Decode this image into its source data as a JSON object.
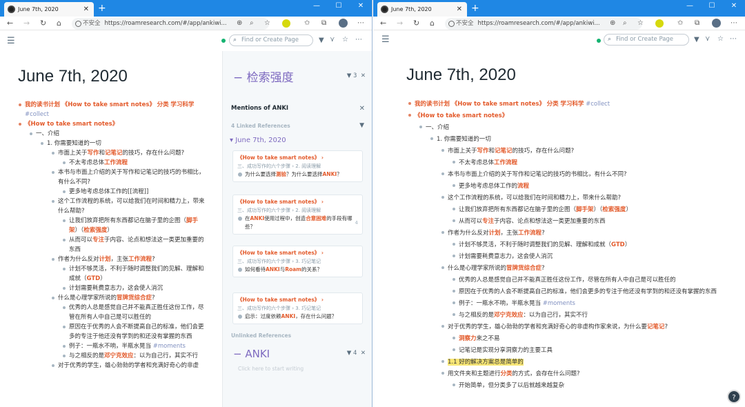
{
  "browser": {
    "tab_title": "June 7th, 2020",
    "new_tab": "+",
    "insecure": "不安全",
    "url_left": "https://roamresearch.com/#/app/ankiwi...",
    "url_right": "https://roamresearch.com/#/app/ankiwi..."
  },
  "search": {
    "placeholder": "Find or Create Page"
  },
  "page": {
    "title": "June 7th, 2020"
  },
  "sidebar": {
    "block_title": "检索强度",
    "block_count": "3",
    "mentions_label": "Mentions of ANKI",
    "linked_refs": "4 Linked References",
    "ref_date": "June 7th, 2020",
    "cards": [
      {
        "ref": "《How to take smart notes》",
        "crumb": "三、成功写作的六个步骤 › 2. 阅读理解",
        "text": "为什么要选择",
        "hl1": "测验",
        "text2": "？为什么要选择",
        "hl2": "ANKI",
        "text3": "？",
        "num": ""
      },
      {
        "ref": "《How to take smart notes》",
        "crumb": "三、成功写作的六个步骤 › 2. 阅读理解",
        "text": "在",
        "hl1": "ANKI",
        "text2": "使用过程中，创造",
        "hl2": "合意困难",
        "text3": "的手段有哪些？",
        "num": "4"
      },
      {
        "ref": "《How to take smart notes》",
        "crumb": "三、成功写作的六个步骤 › 3. 巧记笔记",
        "text": "如何看待",
        "hl1": "ANKI",
        "text2": "与",
        "hl2": "Roam",
        "text3": "的关系？",
        "num": ""
      },
      {
        "ref": "《How to take smart notes》",
        "crumb": "三、成功写作的六个步骤 › 3. 巧记笔记",
        "text": "启示：过度依赖",
        "hl1": "ANKI",
        "text2": "，存在什么问题？",
        "hl2": "",
        "text3": "",
        "num": ""
      }
    ],
    "unlinked_refs": "Unlinked References",
    "anki_title": "ANKI",
    "anki_count": "4",
    "click_here": "Click here to start writing"
  },
  "left_blocks": [
    {
      "d": 0,
      "red": true,
      "html": "<span class='ref'>我的读书计划</span> <span class='ref'>《How to take smart notes》</span> <span class='ref'>分类</span> <span class='ref'>学习科学</span> <span class='tag'>#collect</span>"
    },
    {
      "d": 0,
      "red": true,
      "html": "<span class='ref'>《How to take smart notes》</span>"
    },
    {
      "d": 1,
      "html": "一、介绍"
    },
    {
      "d": 2,
      "html": "1. 你需要知道的一切"
    },
    {
      "d": 3,
      "html": "市面上关于<span class='ref'>写作</span>和<span class='ref'>记笔记</span>的技巧，存在什么问题?"
    },
    {
      "d": 4,
      "html": "不太考虑总体<span class='ref'>工作流程</span>"
    },
    {
      "d": 3,
      "html": "本书与市面上介绍的关于写作和记笔记的技巧的书相比，有什么不同?"
    },
    {
      "d": 4,
      "html": "更多地考虑总体工作的[[流程]]"
    },
    {
      "d": 3,
      "html": "这个工作流程的系统，可以给我们在时间和精力上，带来什么帮助?"
    },
    {
      "d": 4,
      "html": "让我们放弃把所有东西都记在脑子里的企图（<span class='ref'>脚手架</span>）（<span class='ref'>检索强度</span>）"
    },
    {
      "d": 4,
      "html": "从而可以<span class='ref'>专注</span>于内容、论点和想法这一类更加重要的东西"
    },
    {
      "d": 3,
      "html": "作者为什么反对<span class='ref'>计划</span>，主张<span class='ref'>工作流程</span>?"
    },
    {
      "d": 4,
      "html": "计划不够灵活，不利于随时调整我们的见解、理解和成就（<span class='ref'>GTD</span>）"
    },
    {
      "d": 4,
      "html": "计划需要耗费意志力，这会使人消沉"
    },
    {
      "d": 3,
      "html": "什么是心理学家所说的<span class='ref'>冒牌货综合症</span>?"
    },
    {
      "d": 4,
      "html": "优秀的人总是感觉自己并不能真正胜任这份工作，尽管在所有人中自己是可以胜任的"
    },
    {
      "d": 4,
      "html": "原因在于优秀的人会不断提高自己的标准，他们会更多的专注于他还没有学到的和还没有掌握的东西"
    },
    {
      "d": 4,
      "html": "例子：一瓶水不响，半瓶水晃当 <span class='tag'>#moments</span>"
    },
    {
      "d": 4,
      "html": "与之相反的是<span class='ref'>邓宁克效应</span>：以为自己行，其实不行"
    },
    {
      "d": 3,
      "html": "对于优秀的学生，雄心勃勃的学者和充满好奇心的非虚"
    }
  ],
  "right_blocks": [
    {
      "d": 0,
      "red": true,
      "html": "<span class='ref'>我的读书计划</span> <span class='ref'>《How to take smart notes》</span> <span class='ref'>分类</span> <span class='ref'>学习科学</span> <span class='tag'>#collect</span>"
    },
    {
      "d": 0,
      "red": true,
      "html": "<span class='ref'>《How to take smart notes》</span>"
    },
    {
      "d": 1,
      "html": "一、介绍"
    },
    {
      "d": 2,
      "html": "1. 你需要知道的一切"
    },
    {
      "d": 3,
      "html": "市面上关于<span class='ref'>写作</span>和<span class='ref'>记笔记</span>的技巧，存在什么问题?"
    },
    {
      "d": 4,
      "html": "不太考虑总体<span class='ref'>工作流程</span>"
    },
    {
      "d": 3,
      "html": "本书与市面上介绍的关于写作和记笔记的技巧的书相比，有什么不同?"
    },
    {
      "d": 4,
      "html": "更多地考虑总体工作的<span class='ref'>流程</span>"
    },
    {
      "d": 3,
      "html": "这个工作流程的系统，可以给我们在时间和精力上，带来什么帮助?"
    },
    {
      "d": 4,
      "html": "让我们放弃把所有东西都记在脑子里的企图（<span class='ref'>脚手架</span>）（<span class='ref'>检索强度</span>）"
    },
    {
      "d": 4,
      "html": "从而可以<span class='ref'>专注</span>于内容、论点和想法这一类更加重要的东西"
    },
    {
      "d": 3,
      "html": "作者为什么反对<span class='ref'>计划</span>，主张<span class='ref'>工作流程</span>?"
    },
    {
      "d": 4,
      "html": "计划不够灵活，不利于随时调整我们的见解、理解和成就（<span class='ref'>GTD</span>）"
    },
    {
      "d": 4,
      "html": "计划需要耗费意志力，这会使人消沉"
    },
    {
      "d": 3,
      "html": "什么是心理学家所说的<span class='ref'>冒牌货综合症</span>?"
    },
    {
      "d": 4,
      "html": "优秀的人总是感觉自己并不能真正胜任这份工作，尽管在所有人中自己是可以胜任的"
    },
    {
      "d": 4,
      "html": "原因在于优秀的人会不断提高自己的标准，他们会更多的专注于他还没有学到的和还没有掌握的东西"
    },
    {
      "d": 4,
      "html": "例子：一瓶水不响，半瓶水晃当 <span class='tag'>#moments</span>"
    },
    {
      "d": 4,
      "html": "与之相反的是<span class='ref'>邓宁克效应</span>：以为自己行，其实不行"
    },
    {
      "d": 3,
      "html": "对于优秀的学生，雄心勃勃的学者和充满好奇心的非虚构作家来说，为什么要<span class='ref'>记笔记</span>?"
    },
    {
      "d": 4,
      "html": "<span class='ref'>洞察力</span>来之不易"
    },
    {
      "d": 4,
      "html": "记笔记是实现分享洞察力的主要工具"
    },
    {
      "d": 3,
      "html": "<span class='hl'>1.1 好的解决方案总是简单的</span>"
    },
    {
      "d": 3,
      "html": "用文件夹和主题进行<span class='ref'>分类</span>的方式，会存在什么问题?"
    },
    {
      "d": 4,
      "html": "开始简单，但分类多了以后就越来越复杂"
    }
  ]
}
